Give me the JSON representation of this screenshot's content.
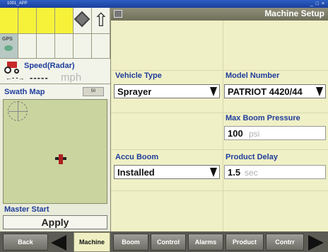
{
  "window": {
    "title": "1001_APP",
    "controls": "_ □ ×"
  },
  "left": {
    "gps_label": "GPS",
    "speed": {
      "title": "Speed(Radar)",
      "arrows": "←- -→",
      "value": "-----",
      "unit": "mph"
    },
    "swath": {
      "title": "Swath Map",
      "zoom_label": "50"
    },
    "master": {
      "title": "Master Start",
      "apply_label": "Apply"
    }
  },
  "main": {
    "title": "Machine Setup",
    "vehicle_type": {
      "label": "Vehicle Type",
      "value": "Sprayer"
    },
    "model_number": {
      "label": "Model Number",
      "value": "PATRIOT 4420/44"
    },
    "max_boom_pressure": {
      "label": "Max Boom Pressure",
      "value": "100",
      "unit": "psi"
    },
    "accu_boom": {
      "label": "Accu Boom",
      "value": "Installed"
    },
    "product_delay": {
      "label": "Product Delay",
      "value": "1.5",
      "unit": "sec"
    }
  },
  "nav": {
    "back": "Back",
    "machine": "Machine",
    "boom": "Boom",
    "control": "Control",
    "alarms": "Alarms",
    "product": "Product",
    "contr": "Contrr"
  },
  "colors": {
    "accent": "#1f3d9c",
    "panel_bg": "#f0f0c6",
    "status_yellow": "#f6f23a"
  }
}
